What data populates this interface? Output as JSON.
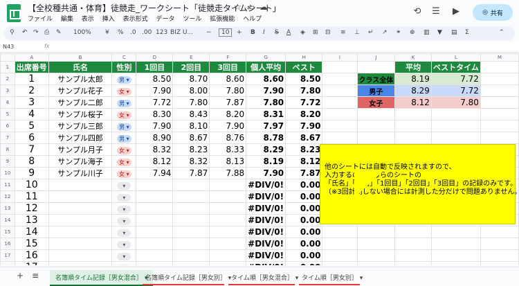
{
  "title": "【全校種共通・体育】徒競走_ワークシート「徒競走タイムシート」",
  "menu": [
    "ファイル",
    "編集",
    "表示",
    "挿入",
    "表示形式",
    "データ",
    "ツール",
    "拡張機能",
    "ヘルプ"
  ],
  "share_label": "共有",
  "toolbar": {
    "zoom": "100%",
    "currency": "¥",
    "percent": "%",
    "dec_less": ".0",
    "dec_more": ".00",
    "fmt123": "123",
    "font": "BIZ U...",
    "font_size": "10",
    "bold": "B",
    "italic": "I",
    "strike": "S",
    "textcolor": "A"
  },
  "namebox": "N43",
  "fx": "fx",
  "columns": [
    "",
    "A",
    "B",
    "C",
    "D",
    "E",
    "F",
    "G",
    "H",
    "I",
    "J",
    "K",
    "L",
    "M"
  ],
  "header": {
    "row": "1",
    "cells": [
      "出席番号",
      "氏名",
      "性別",
      "1回目",
      "2回目",
      "3回目",
      "個人平均",
      "ベスト"
    ]
  },
  "rows": [
    {
      "row": "2",
      "no": "1",
      "name": "サンプル太郎",
      "sex": "男",
      "t1": "8.50",
      "t2": "8.70",
      "t3": "8.60",
      "avg": "8.60",
      "best": "8.50"
    },
    {
      "row": "3",
      "no": "2",
      "name": "サンプル花子",
      "sex": "女",
      "t1": "7.90",
      "t2": "8.00",
      "t3": "7.80",
      "avg": "7.90",
      "best": "7.80"
    },
    {
      "row": "4",
      "no": "3",
      "name": "サンプル二郎",
      "sex": "男",
      "t1": "7.72",
      "t2": "7.80",
      "t3": "7.87",
      "avg": "7.80",
      "best": "7.72"
    },
    {
      "row": "5",
      "no": "4",
      "name": "サンプル桜子",
      "sex": "女",
      "t1": "8.30",
      "t2": "8.43",
      "t3": "8.20",
      "avg": "8.31",
      "best": "8.20"
    },
    {
      "row": "6",
      "no": "5",
      "name": "サンプル三郎",
      "sex": "男",
      "t1": "7.90",
      "t2": "8.10",
      "t3": "7.90",
      "avg": "7.97",
      "best": "7.90"
    },
    {
      "row": "7",
      "no": "6",
      "name": "サンプル四郎",
      "sex": "男",
      "t1": "8.90",
      "t2": "8.67",
      "t3": "8.76",
      "avg": "8.78",
      "best": "8.67"
    },
    {
      "row": "8",
      "no": "7",
      "name": "サンプル月子",
      "sex": "女",
      "t1": "8.32",
      "t2": "8.23",
      "t3": "8.33",
      "avg": "8.29",
      "best": "8.23"
    },
    {
      "row": "9",
      "no": "8",
      "name": "サンプル海子",
      "sex": "女",
      "t1": "8.12",
      "t2": "8.32",
      "t3": "8.13",
      "avg": "8.19",
      "best": "8.12"
    },
    {
      "row": "10",
      "no": "9",
      "name": "サンプル川子",
      "sex": "女",
      "t1": "7.94",
      "t2": "7.87",
      "t3": "7.88",
      "avg": "7.90",
      "best": "7.87"
    },
    {
      "row": "11",
      "no": "10",
      "name": "",
      "sex": "",
      "t1": "",
      "t2": "",
      "t3": "",
      "avg": "#DIV/0!",
      "best": "0.00"
    },
    {
      "row": "12",
      "no": "11",
      "name": "",
      "sex": "",
      "t1": "",
      "t2": "",
      "t3": "",
      "avg": "#DIV/0!",
      "best": "0.00"
    },
    {
      "row": "13",
      "no": "12",
      "name": "",
      "sex": "",
      "t1": "",
      "t2": "",
      "t3": "",
      "avg": "#DIV/0!",
      "best": "0.00"
    },
    {
      "row": "14",
      "no": "13",
      "name": "",
      "sex": "",
      "t1": "",
      "t2": "",
      "t3": "",
      "avg": "#DIV/0!",
      "best": "0.00"
    },
    {
      "row": "15",
      "no": "14",
      "name": "",
      "sex": "",
      "t1": "",
      "t2": "",
      "t3": "",
      "avg": "#DIV/0!",
      "best": "0.00"
    },
    {
      "row": "16",
      "no": "15",
      "name": "",
      "sex": "",
      "t1": "",
      "t2": "",
      "t3": "",
      "avg": "#DIV/0!",
      "best": "0.00"
    },
    {
      "row": "17",
      "no": "16",
      "name": "",
      "sex": "",
      "t1": "",
      "t2": "",
      "t3": "",
      "avg": "#DIV/0!",
      "best": "0.00"
    },
    {
      "row": "18",
      "no": "17",
      "name": "",
      "sex": "",
      "t1": "",
      "t2": "",
      "t3": "",
      "avg": "#DIV/0!",
      "best": "0.00"
    }
  ],
  "summary": {
    "hdr_avg": "平均",
    "hdr_best": "ベストタイム",
    "rows": [
      {
        "label": "クラス全体",
        "avg": "8.19",
        "best": "7.72"
      },
      {
        "label": "男子",
        "avg": "8.29",
        "best": "7.72"
      },
      {
        "label": "女子",
        "avg": "8.12",
        "best": "7.80"
      }
    ]
  },
  "note": [
    "他のシートには自動で反映されますので、",
    "入力するのはこちらのシートの",
    "「氏名」「性別」「1回目」「2回目」「3回目」の記録のみです。",
    "（※3回計測しない場合には計測した分だけで問題ありません。"
  ],
  "tabs": [
    {
      "label": "名簿順タイム記録［男女混合］",
      "active": true
    },
    {
      "label": "名簿順タイム記録［男女別］",
      "active": false
    },
    {
      "label": "タイム順［男女混合］",
      "active": false
    },
    {
      "label": "タイム順［男女別］",
      "active": false
    }
  ],
  "colors": {
    "header_green": "#1e8a3e",
    "male_blue": "#4a86e8",
    "female_red": "#e06666",
    "note_yellow": "#ffff00"
  }
}
